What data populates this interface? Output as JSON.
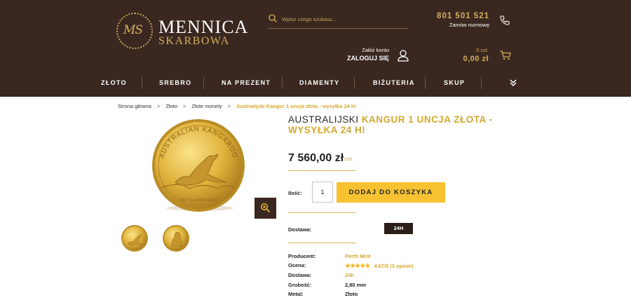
{
  "header": {
    "logo": {
      "emblem": "MS",
      "line1": "MENNICA",
      "line2": "SKARBOWA"
    },
    "search": {
      "placeholder": "Wpisz czego szukasz..."
    },
    "phone": {
      "number": "801 501 521",
      "sub": "Zamów rozmowę"
    },
    "account": {
      "sub": "Załóż konto",
      "main": "ZALOGUJ SIĘ"
    },
    "cart": {
      "count": "0 szt.",
      "total": "0,00 zł"
    }
  },
  "nav": {
    "items": [
      "ZŁOTO",
      "SREBRO",
      "NA PREZENT",
      "DIAMENTY",
      "BIŻUTERIA",
      "SKUP"
    ]
  },
  "breadcrumb": [
    "Strona główna",
    "Złoto",
    "Złote monety",
    "Australijski Kangur 1 uncja złota - wysyłka 24 h!"
  ],
  "product": {
    "title_plain": "AUSTRALIJSKI ",
    "title_gold": "KANGUR 1 UNCJA ZŁOTA - WYSYŁKA 24 H!",
    "price": "7 560,00 zł",
    "price_unit": "/szt.",
    "qty_label": "Ilość:",
    "qty_value": "1",
    "add_to_cart": "DODAJ DO KOSZYKA",
    "delivery_label": "Dostawa:",
    "delivery_badge": "24H",
    "coin_text_top": "AUSTRALIAN KANGAROO",
    "coin_text_bottom": "2017 1oz 9999 GOLD",
    "details": [
      {
        "key": "Producent:",
        "value": "Perth Mint"
      },
      {
        "key": "Ocena:",
        "stars": "★★★★★",
        "value": "4.67/5 (3 opinie)"
      },
      {
        "key": "Dostawa:",
        "value": "24h"
      },
      {
        "key": "Grubość:",
        "value": "2,80 mm"
      },
      {
        "key": "Metal:",
        "value": "Złoto"
      }
    ]
  },
  "colors": {
    "header_bg": "#3a2820",
    "gold": "#d4af5f",
    "accent_yellow": "#f6c232"
  },
  "icons": [
    "search-icon",
    "phone-icon",
    "user-icon",
    "cart-icon",
    "chevron-down-icon",
    "zoom-icon"
  ]
}
